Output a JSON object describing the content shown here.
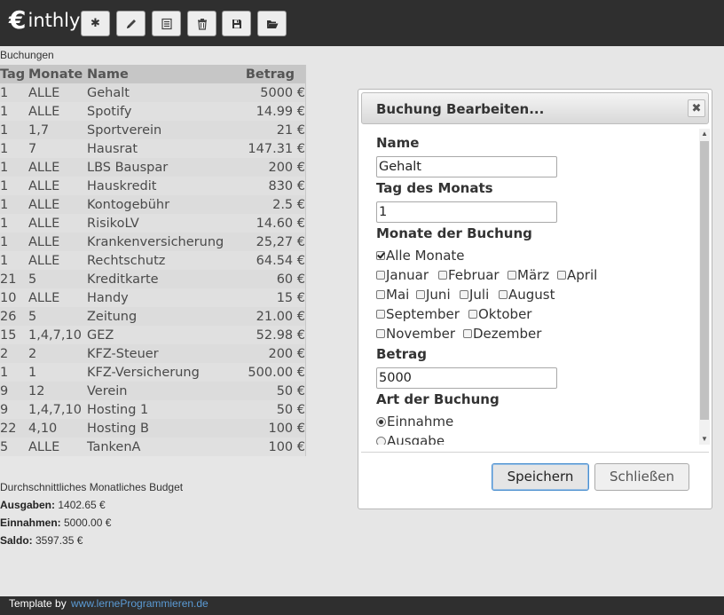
{
  "app": {
    "logo_symbol": "€",
    "logo_text": "inthly"
  },
  "toolbar": [
    {
      "name": "new-button",
      "icon": "asterisk-icon",
      "glyph": "✱"
    },
    {
      "name": "edit-button",
      "icon": "pencil-icon"
    },
    {
      "name": "list-button",
      "icon": "list-icon"
    },
    {
      "name": "delete-button",
      "icon": "trash-icon"
    },
    {
      "name": "save-button",
      "icon": "floppy-disk-icon"
    },
    {
      "name": "open-button",
      "icon": "folder-open-icon"
    }
  ],
  "bookings": {
    "title": "Buchungen",
    "columns": [
      "Tag",
      "Monate",
      "Name",
      "Betrag"
    ],
    "rows": [
      [
        "1",
        "ALLE",
        "Gehalt",
        "5000 €"
      ],
      [
        "1",
        "ALLE",
        "Spotify",
        "14.99 €"
      ],
      [
        "1",
        "1,7",
        "Sportverein",
        "21 €"
      ],
      [
        "1",
        "7",
        "Hausrat",
        "147.31 €"
      ],
      [
        "1",
        "ALLE",
        "LBS Bauspar",
        "200 €"
      ],
      [
        "1",
        "ALLE",
        "Hauskredit",
        "830 €"
      ],
      [
        "1",
        "ALLE",
        "Kontogebühr",
        "2.5 €"
      ],
      [
        "1",
        "ALLE",
        "RisikoLV",
        "14.60 €"
      ],
      [
        "1",
        "ALLE",
        "Krankenversicherung",
        "25,27 €"
      ],
      [
        "1",
        "ALLE",
        "Rechtschutz",
        "64.54 €"
      ],
      [
        "21",
        "5",
        "Kreditkarte",
        "60 €"
      ],
      [
        "10",
        "ALLE",
        "Handy",
        "15 €"
      ],
      [
        "26",
        "5",
        "Zeitung",
        "21.00 €"
      ],
      [
        "15",
        "1,4,7,10",
        "GEZ",
        "52.98 €"
      ],
      [
        "2",
        "2",
        "KFZ-Steuer",
        "200 €"
      ],
      [
        "1",
        "1",
        "KFZ-Versicherung",
        "500.00 €"
      ],
      [
        "9",
        "12",
        "Verein",
        "50 €"
      ],
      [
        "9",
        "1,4,7,10",
        "Hosting 1",
        "50 €"
      ],
      [
        "22",
        "4,10",
        "Hosting B",
        "100 €"
      ],
      [
        "5",
        "ALLE",
        "TankenA",
        "100 €"
      ]
    ]
  },
  "summary": {
    "title": "Durchschnittliches Monatliches Budget",
    "ausgaben_label": "Ausgaben:",
    "ausgaben_value": " 1402.65 €",
    "einnahmen_label": "Einnahmen:",
    "einnahmen_value": " 5000.00 €",
    "saldo_label": "Saldo:",
    "saldo_value": " 3597.35 €"
  },
  "dialog": {
    "title": "Buchung Bearbeiten...",
    "close_glyph": "✖",
    "name_label": "Name",
    "name_value": "Gehalt",
    "tag_label": "Tag des Monats",
    "tag_value": "1",
    "monate_label": "Monate der Buchung",
    "alle_monate": {
      "label": "Alle Monate",
      "checked": true
    },
    "months": [
      "Januar",
      "Februar",
      "März",
      "April",
      "Mai",
      "Juni",
      "Juli",
      "August",
      "September",
      "Oktober",
      "November",
      "Dezember"
    ],
    "betrag_label": "Betrag",
    "betrag_value": "5000",
    "art_label": "Art der Buchung",
    "art_options": [
      {
        "label": "Einnahme",
        "selected": true
      },
      {
        "label": "Ausgabe",
        "selected": false
      }
    ],
    "save_label": "Speichern",
    "close_label": "Schließen"
  },
  "footer": {
    "prefix": "Template by",
    "link": "www.lerneProgrammieren.de"
  },
  "colors": {
    "topbar": "#2f2f2f",
    "link": "#5b9bd5",
    "save_button_border": "#4a8fcf"
  }
}
